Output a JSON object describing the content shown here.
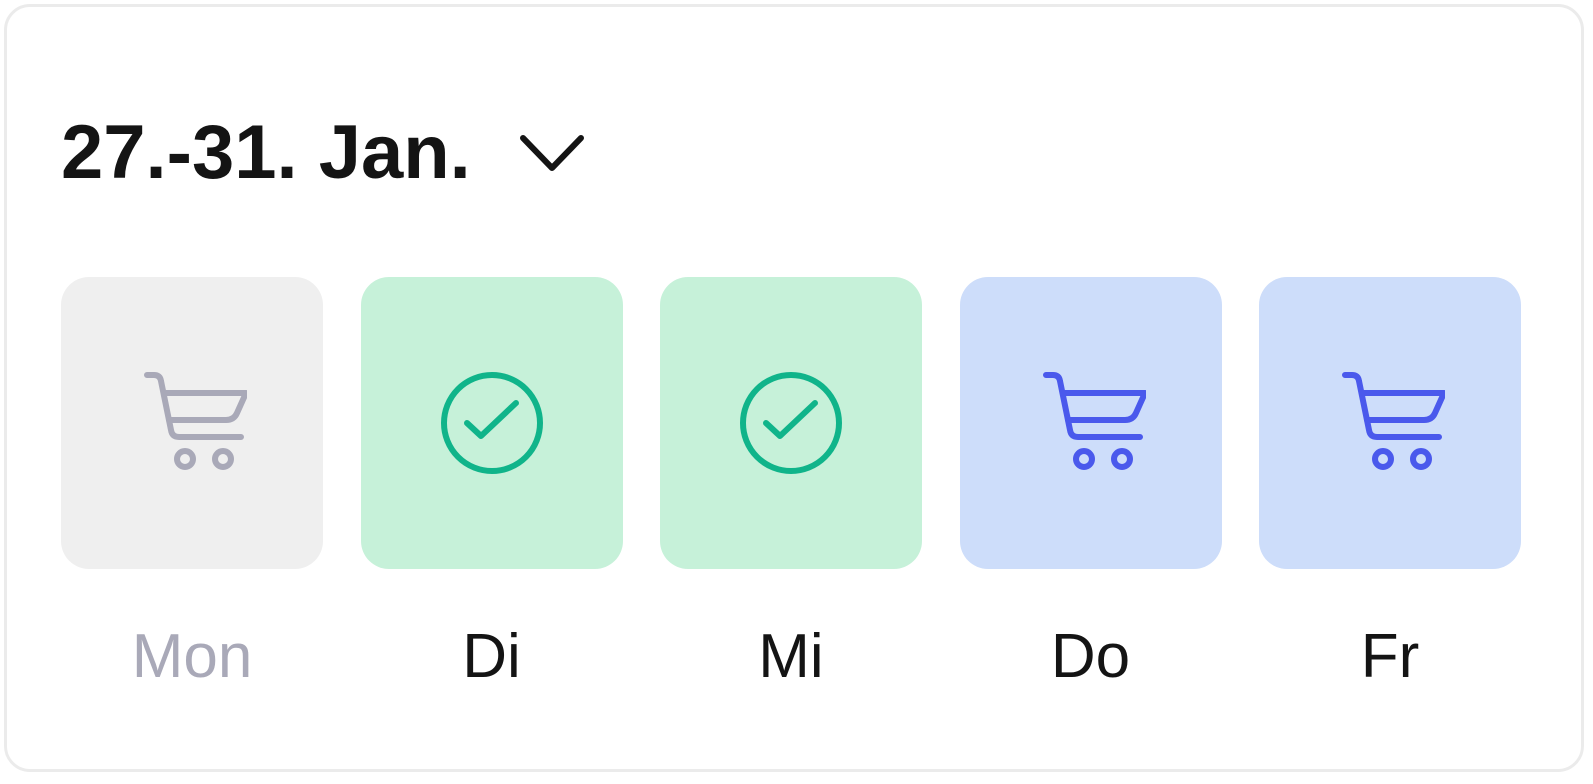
{
  "week_selector": {
    "label": "27.-31. Jan.",
    "icon": "chevron-down-icon"
  },
  "days": [
    {
      "label": "Mon",
      "status": "disabled",
      "icon": "shopping-cart-icon",
      "tile_color": "#efefef",
      "icon_color": "#a9a9b8",
      "label_color": "#a9a9b8"
    },
    {
      "label": "Di",
      "status": "ordered",
      "icon": "check-circle-icon",
      "tile_color": "#c6f1d9",
      "icon_color": "#10b48a",
      "label_color": "#141414"
    },
    {
      "label": "Mi",
      "status": "ordered",
      "icon": "check-circle-icon",
      "tile_color": "#c6f1d9",
      "icon_color": "#10b48a",
      "label_color": "#141414"
    },
    {
      "label": "Do",
      "status": "available",
      "icon": "shopping-cart-icon",
      "tile_color": "#cdddfa",
      "icon_color": "#4a59ec",
      "label_color": "#141414"
    },
    {
      "label": "Fr",
      "status": "available",
      "icon": "shopping-cart-icon",
      "tile_color": "#cdddfa",
      "icon_color": "#4a59ec",
      "label_color": "#141414"
    }
  ]
}
